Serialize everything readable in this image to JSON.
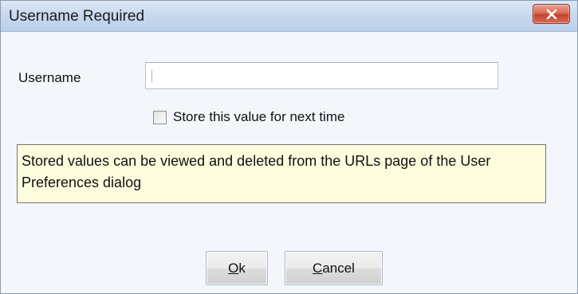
{
  "window": {
    "title": "Username Required"
  },
  "form": {
    "username_label": "Username",
    "username_value": "",
    "store_checkbox_label": "Store this value for next time",
    "store_checked": false
  },
  "info": {
    "text": "Stored values can be viewed and deleted from the URLs page of the User Preferences dialog"
  },
  "buttons": {
    "ok_mnemonic": "O",
    "ok_rest": "k",
    "cancel_mnemonic": "C",
    "cancel_rest": "ancel"
  },
  "icons": {
    "close": "close-icon"
  },
  "colors": {
    "close_button": "#d45a45",
    "info_background": "#fdfdde",
    "titlebar": "#c7d8ee"
  }
}
